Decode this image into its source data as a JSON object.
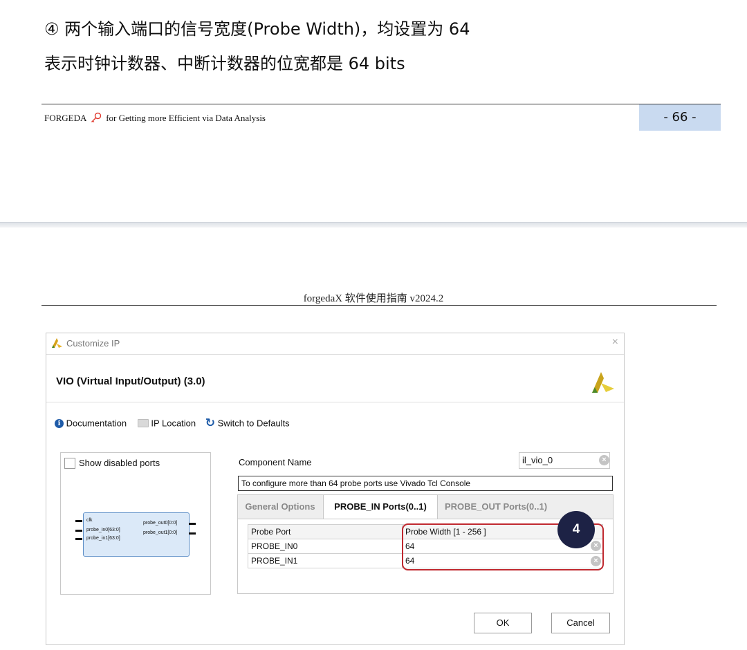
{
  "doc": {
    "line1": "④ 两个输入端口的信号宽度(Probe Width)，均设置为 64",
    "line2": "表示时钟计数器、中断计数器的位宽都是 64 bits",
    "footer_left_before": "FORGEDA",
    "footer_left_after": "for Getting more Efficient via Data Analysis",
    "page_number": "- 66 -",
    "header2": "forgedaX 软件使用指南 v2024.2"
  },
  "dialog": {
    "window_title": "Customize IP",
    "close": "×",
    "ip_name": "VIO (Virtual Input/Output) (3.0)",
    "toolbar": {
      "documentation": "Documentation",
      "ip_location": "IP Location",
      "switch_defaults": "Switch to Defaults"
    },
    "show_disabled_ports": "Show disabled ports",
    "symbol": {
      "clk": "clk",
      "in0": "probe_in0[63:0]",
      "in1": "probe_in1[63:0]",
      "out0": "probe_out0[0:0]",
      "out1": "probe_out1[0:0]"
    },
    "component_name_label": "Component Name",
    "component_name_value": "il_vio_0",
    "note": "To configure more than 64 probe ports use Vivado Tcl Console",
    "tabs": [
      "General Options",
      "PROBE_IN Ports(0..1)",
      "PROBE_OUT Ports(0..1)"
    ],
    "table": {
      "headers": [
        "Probe Port",
        "Probe Width [1 - 256 ]"
      ],
      "rows": [
        {
          "port": "PROBE_IN0",
          "width": "64"
        },
        {
          "port": "PROBE_IN1",
          "width": "64"
        }
      ]
    },
    "badge": "4",
    "ok": "OK",
    "cancel": "Cancel"
  },
  "colors": {
    "accent": "#1e5ba8",
    "annotation": "#c0282f",
    "badge": "#1d2245",
    "page_number_bg": "#c9daf0"
  }
}
